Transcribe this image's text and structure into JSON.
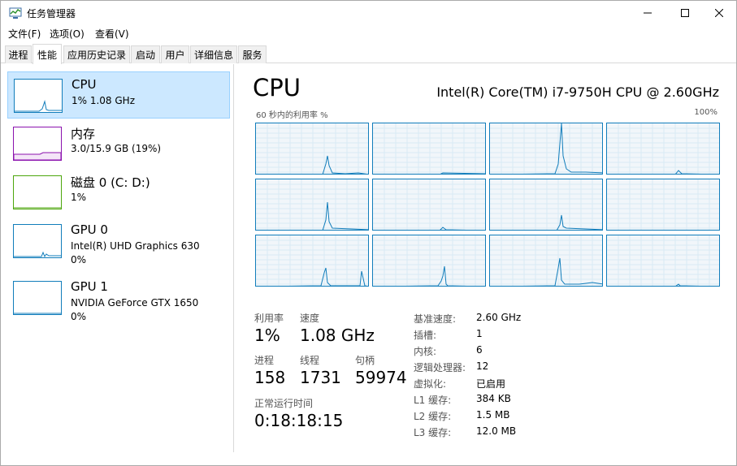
{
  "window": {
    "title": "任务管理器",
    "menu": [
      "文件(F)",
      "选项(O)",
      "查看(V)"
    ],
    "tabs": [
      "进程",
      "性能",
      "应用历史记录",
      "启动",
      "用户",
      "详细信息",
      "服务"
    ],
    "active_tab": 1
  },
  "sidebar": {
    "items": [
      {
        "name": "CPU",
        "sub1": "1% 1.08 GHz",
        "sub2": "",
        "color": "#117dbb"
      },
      {
        "name": "内存",
        "sub1": "3.0/15.9 GB (19%)",
        "sub2": "",
        "color": "#8b12ae"
      },
      {
        "name": "磁盘 0 (C: D:)",
        "sub1": "1%",
        "sub2": "",
        "color": "#4da60c"
      },
      {
        "name": "GPU 0",
        "sub1": "Intel(R) UHD Graphics 630",
        "sub2": "0%",
        "color": "#117dbb"
      },
      {
        "name": "GPU 1",
        "sub1": "NVIDIA GeForce GTX 1650",
        "sub2": "0%",
        "color": "#117dbb"
      }
    ]
  },
  "main": {
    "title": "CPU",
    "model": "Intel(R) Core(TM) i7-9750H CPU @ 2.60GHz",
    "graph_caption": "60 秒内的利用率 %",
    "graph_max": "100%",
    "stats": {
      "util_label": "利用率",
      "util_value": "1%",
      "speed_label": "速度",
      "speed_value": "1.08 GHz",
      "proc_label": "进程",
      "proc_value": "158",
      "thread_label": "线程",
      "thread_value": "1731",
      "handle_label": "句柄",
      "handle_value": "59974",
      "uptime_label": "正常运行时间",
      "uptime_value": "0:18:18:15"
    },
    "specs": [
      {
        "label": "基准速度:",
        "value": "2.60 GHz"
      },
      {
        "label": "插槽:",
        "value": "1"
      },
      {
        "label": "内核:",
        "value": "6"
      },
      {
        "label": "逻辑处理器:",
        "value": "12"
      },
      {
        "label": "虚拟化:",
        "value": "已启用"
      },
      {
        "label": "L1 缓存:",
        "value": "384 KB"
      },
      {
        "label": "L2 缓存:",
        "value": "1.5 MB"
      },
      {
        "label": "L3 缓存:",
        "value": "12.0 MB"
      }
    ]
  },
  "colors": {
    "accent": "#117dbb",
    "selected_bg": "#cce8ff",
    "memory": "#8b12ae",
    "disk": "#4da60c"
  }
}
